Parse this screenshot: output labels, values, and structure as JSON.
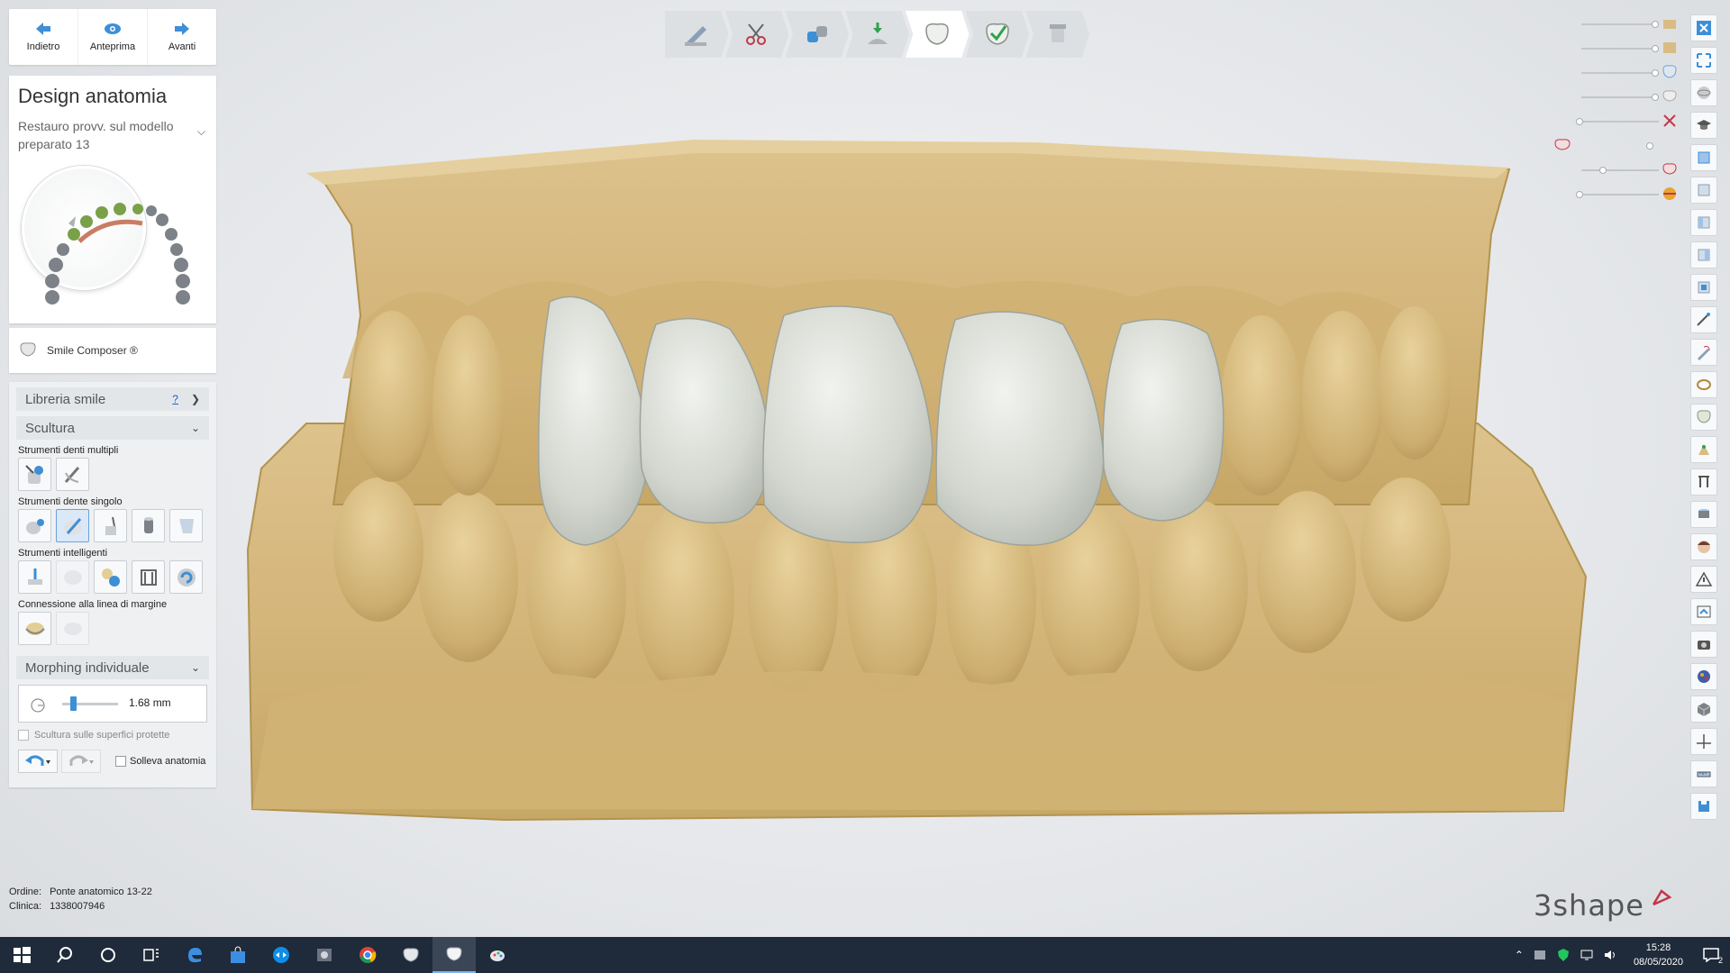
{
  "navigation": {
    "back_label": "Indietro",
    "preview_label": "Anteprima",
    "forward_label": "Avanti"
  },
  "design_panel": {
    "title": "Design anatomia",
    "subtitle": "Restauro provv. sul modello preparato 13"
  },
  "smile_composer": {
    "label": "Smile Composer ®"
  },
  "tools": {
    "library_label": "Libreria smile",
    "help_label": "?",
    "sculpt_label": "Scultura",
    "multi_teeth_label": "Strumenti denti multipli",
    "single_tooth_label": "Strumenti dente singolo",
    "smart_tools_label": "Strumenti intelligenti",
    "margin_connection_label": "Connessione alla linea di margine",
    "morphing_label": "Morphing individuale",
    "morph_value": "1.68 mm",
    "morph_level": 0.15,
    "protected_surfaces_label": "Scultura sulle superfici protette",
    "lift_anatomy_label": "Solleva anatomia"
  },
  "order": {
    "order_key": "Ordine:",
    "order_value": "Ponte anatomico 13-22",
    "clinic_key": "Clinica:",
    "clinic_value": "1338007946"
  },
  "brand": {
    "name": "3shape"
  },
  "colors": {
    "model": "#d9bc84",
    "model_shadow": "#b99b60",
    "crown": "#d6d9d2",
    "accent": "#3d8fd6",
    "brand_mark": "#c0384b"
  },
  "workflow_steps": [
    "pencil-icon",
    "scissors-icon",
    "connector-icon",
    "die-icon",
    "tooth-icon",
    "tooth-check-icon",
    "crown-icon"
  ],
  "right_tools": [
    "close-icon",
    "fullscreen-icon",
    "sphere-icon",
    "graduation-cap-icon",
    "view-front-icon",
    "view-back-icon",
    "view-left-icon",
    "view-right-icon",
    "measure-icon",
    "edit-icon",
    "ring-icon",
    "tooth-view-icon",
    "marker-icon",
    "section-icon",
    "cylinder-icon",
    "face-icon",
    "warning-icon",
    "screenshot-icon",
    "camera-icon",
    "palette-icon",
    "cube-icon",
    "crosshair-icon",
    "ruler-icon",
    "save-icon"
  ],
  "taskbar": {
    "time": "15:28",
    "date": "08/05/2020",
    "notif_count": "2"
  }
}
